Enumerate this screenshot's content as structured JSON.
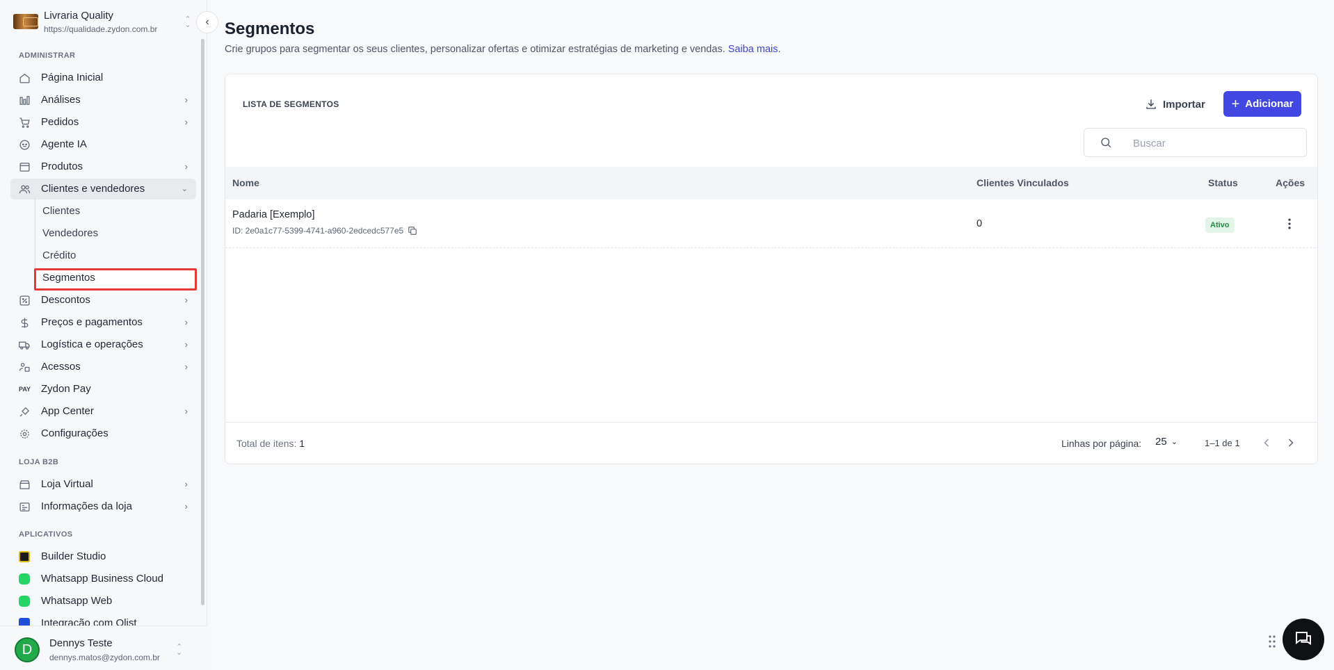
{
  "org": {
    "name": "Livraria Quality",
    "url": "https://qualidade.zydon.com.br"
  },
  "sidebar": {
    "sections": {
      "admin": "ADMINISTRAR",
      "b2b": "LOJA B2B",
      "apps": "APLICATIVOS"
    },
    "admin_items": [
      {
        "label": "Página Inicial"
      },
      {
        "label": "Análises"
      },
      {
        "label": "Pedidos"
      },
      {
        "label": "Agente IA"
      },
      {
        "label": "Produtos"
      },
      {
        "label": "Clientes e vendedores"
      },
      {
        "label": "Descontos"
      },
      {
        "label": "Preços e pagamentos"
      },
      {
        "label": "Logística e operações"
      },
      {
        "label": "Acessos"
      },
      {
        "label": "Zydon Pay"
      },
      {
        "label": "App Center"
      },
      {
        "label": "Configurações"
      }
    ],
    "sub_items": [
      {
        "label": "Clientes"
      },
      {
        "label": "Vendedores"
      },
      {
        "label": "Crédito"
      },
      {
        "label": "Segmentos"
      }
    ],
    "b2b_items": [
      {
        "label": "Loja Virtual"
      },
      {
        "label": "Informações da loja"
      }
    ],
    "app_items": [
      {
        "label": "Builder Studio"
      },
      {
        "label": "Whatsapp Business Cloud"
      },
      {
        "label": "Whatsapp Web"
      },
      {
        "label": "Integração com Olist"
      }
    ],
    "pay_icon_text": "PAY"
  },
  "user": {
    "initial": "D",
    "name": "Dennys Teste",
    "email": "dennys.matos@zydon.com.br"
  },
  "page": {
    "title": "Segmentos",
    "description": "Crie grupos para segmentar os seus clientes, personalizar ofertas e otimizar estratégias de marketing e vendas.",
    "learn_more": "Saiba mais",
    "learn_more_suffix": "."
  },
  "card": {
    "title": "LISTA DE SEGMENTOS",
    "import_label": "Importar",
    "add_label": "Adicionar",
    "search_placeholder": "Buscar"
  },
  "table": {
    "columns": {
      "name": "Nome",
      "clients": "Clientes Vinculados",
      "status": "Status",
      "actions": "Ações"
    },
    "rows": [
      {
        "name": "Padaria [Exemplo]",
        "id": "ID: 2e0a1c77-5399-4741-a960-2edcedc577e5",
        "clients": "0",
        "status": "Ativo"
      }
    ]
  },
  "footer": {
    "total_label": "Total de itens:",
    "total_value": "1",
    "rows_per_page_label": "Linhas por página:",
    "rows_per_page_value": "25",
    "range": "1–1 de 1"
  },
  "colors": {
    "accent": "#4147e0",
    "link": "#3b45d9",
    "active_badge_bg": "#e3f5e8",
    "active_badge_fg": "#1f8a3e",
    "highlight": "#e53935"
  }
}
